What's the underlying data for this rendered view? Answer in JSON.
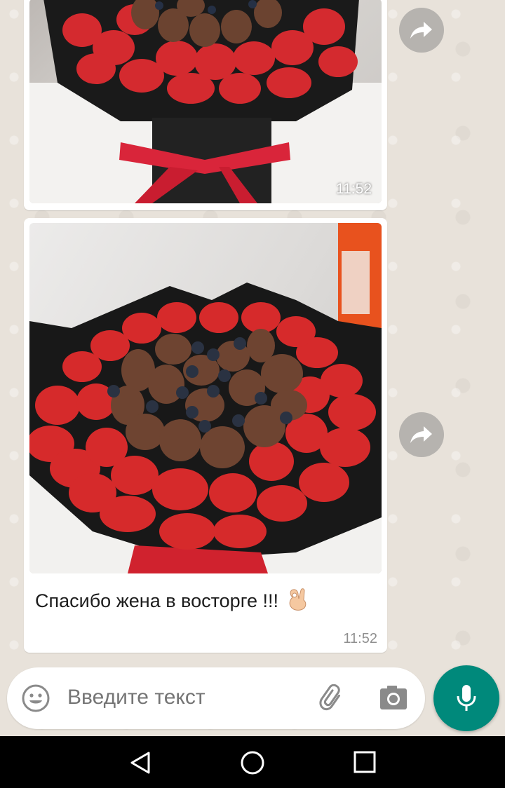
{
  "messages": [
    {
      "type": "image",
      "time": "11:52",
      "image": "strawberry-bouquet-photo"
    },
    {
      "type": "image-caption",
      "time": "11:52",
      "image": "strawberry-chocolate-bouquet-photo",
      "caption": "Спасибо жена в восторге !!!",
      "emoji": "ok-hand"
    }
  ],
  "composer": {
    "placeholder": "Введите текст",
    "emoji_icon": "smiley-icon",
    "attach_icon": "paperclip-icon",
    "camera_icon": "camera-icon",
    "mic_icon": "microphone-icon"
  },
  "forward_icon": "forward-arrow-icon",
  "navigation": {
    "back": "back-triangle-icon",
    "home": "home-circle-icon",
    "recent": "recent-square-icon"
  },
  "colors": {
    "accent": "#00897b",
    "bubble": "#ffffff",
    "background": "#e8e2da",
    "navbar": "#000000"
  }
}
